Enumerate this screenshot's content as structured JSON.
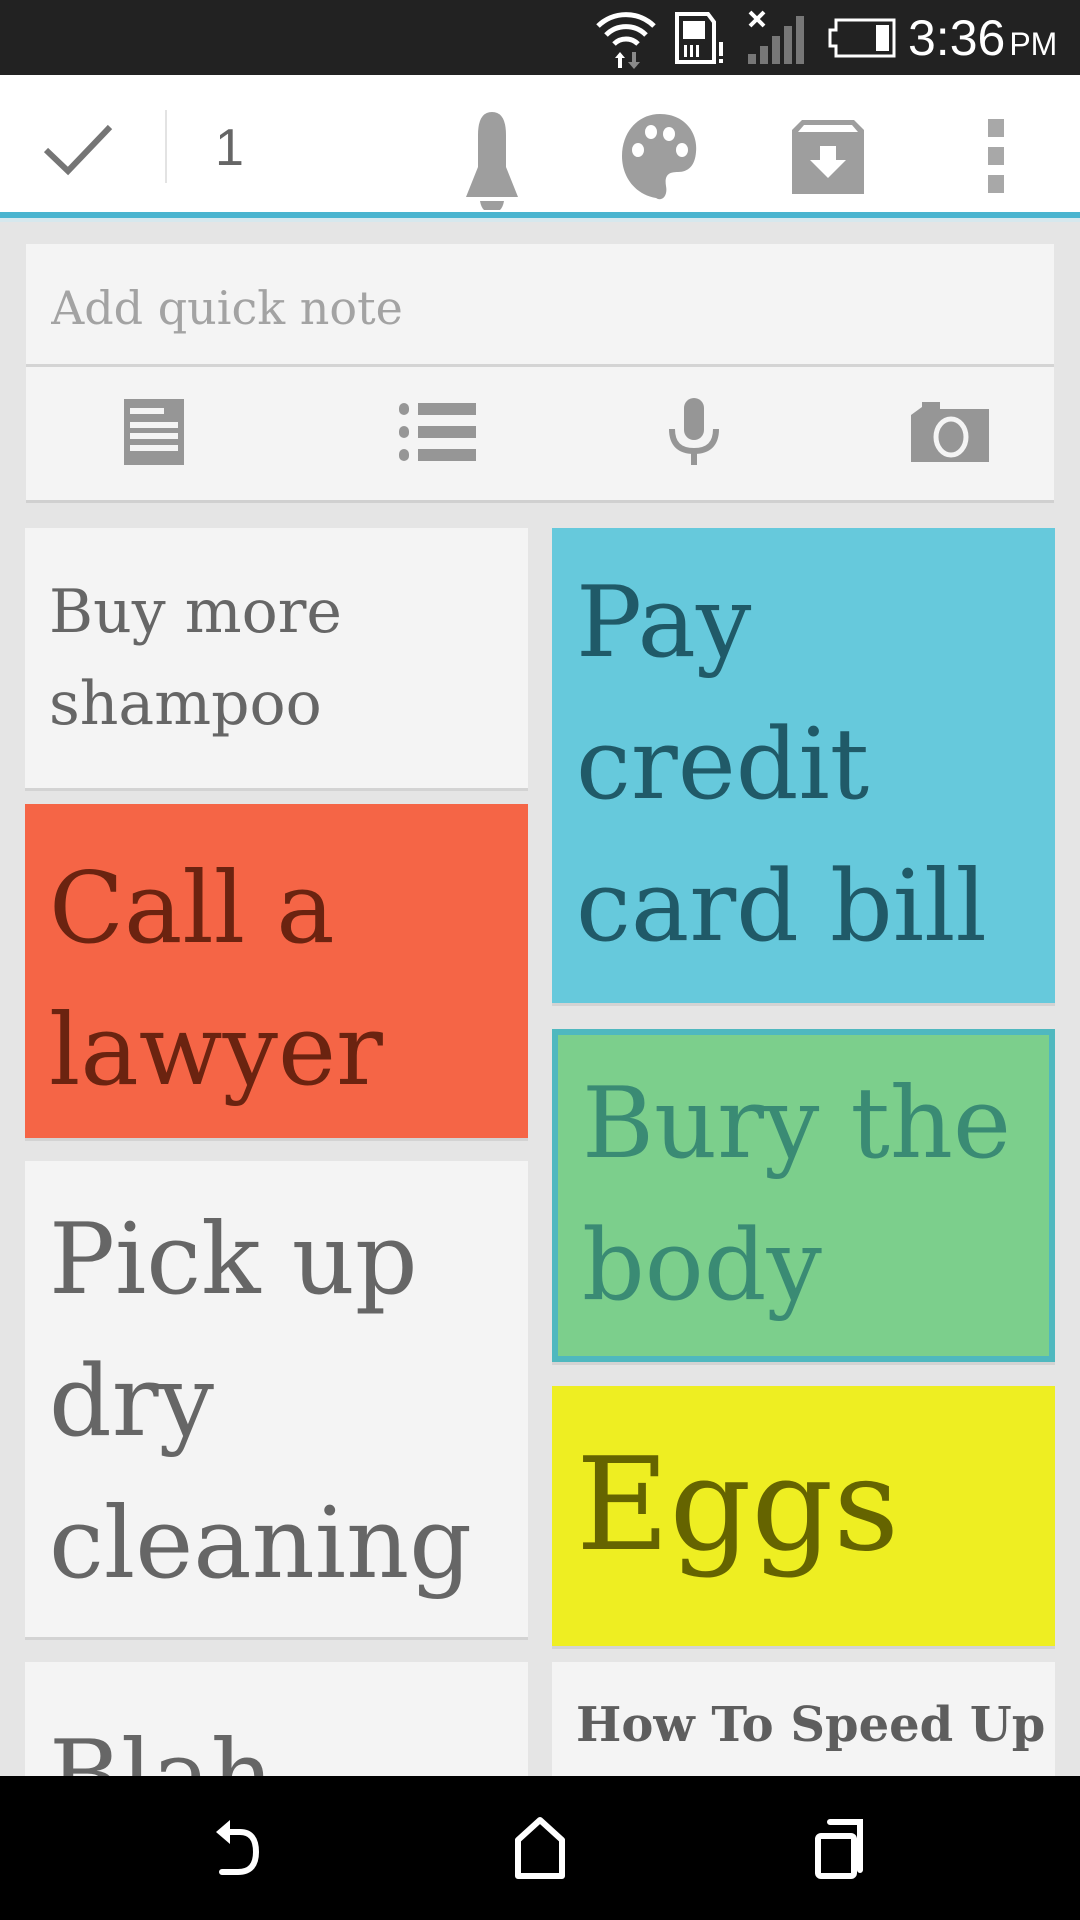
{
  "status_bar": {
    "time": "3:36",
    "ampm": "PM",
    "icons": [
      "wifi-icon",
      "sim-card-alert-icon",
      "signal-no-service-icon",
      "battery-icon"
    ]
  },
  "toolbar": {
    "done_icon": "checkmark-icon",
    "selected_count": "1",
    "actions": [
      {
        "name": "reminder",
        "icon": "bell-icon"
      },
      {
        "name": "color",
        "icon": "palette-icon"
      },
      {
        "name": "archive",
        "icon": "archive-icon"
      },
      {
        "name": "more",
        "icon": "more-vert-icon"
      }
    ],
    "accent_color": "#4ab4cf"
  },
  "quick_note": {
    "placeholder": "Add quick note",
    "actions": [
      {
        "name": "new-text-note",
        "icon": "text-note-icon"
      },
      {
        "name": "new-list",
        "icon": "list-icon"
      },
      {
        "name": "voice-note",
        "icon": "microphone-icon"
      },
      {
        "name": "photo-note",
        "icon": "camera-icon"
      }
    ]
  },
  "notes": {
    "left": [
      {
        "lines": [
          "Buy more",
          "shampoo"
        ],
        "color": "#f4f4f4",
        "text_color": "#666666",
        "selected": false
      },
      {
        "lines": [
          "Call a",
          "lawyer"
        ],
        "color": "#f56546",
        "text_color": "#6b2310",
        "selected": false
      },
      {
        "lines": [
          "Pick up",
          "dry",
          "cleaning"
        ],
        "color": "#f4f4f4",
        "text_color": "#666666",
        "selected": false
      },
      {
        "lines": [
          "Blah"
        ],
        "color": "#f4f4f4",
        "text_color": "#666666",
        "selected": false
      }
    ],
    "right": [
      {
        "lines": [
          "Pay",
          "credit",
          "card bill"
        ],
        "color": "#66c9dc",
        "text_color": "#205a68",
        "selected": false
      },
      {
        "lines": [
          "Bury the",
          "body"
        ],
        "color": "#7ccf8c",
        "text_color": "#3a8b74",
        "selected": true,
        "border_color": "#4fb8bf"
      },
      {
        "lines": [
          "Eggs"
        ],
        "color": "#eeee22",
        "text_color": "#656400",
        "selected": false
      },
      {
        "lines": [
          "How To Speed Up"
        ],
        "color": "#f4f4f4",
        "text_color": "#5e5e5e",
        "selected": false,
        "bold": true
      }
    ]
  },
  "nav_bar": {
    "buttons": [
      {
        "name": "back",
        "icon": "back-icon"
      },
      {
        "name": "home",
        "icon": "home-icon"
      },
      {
        "name": "recents",
        "icon": "recents-icon"
      }
    ]
  }
}
